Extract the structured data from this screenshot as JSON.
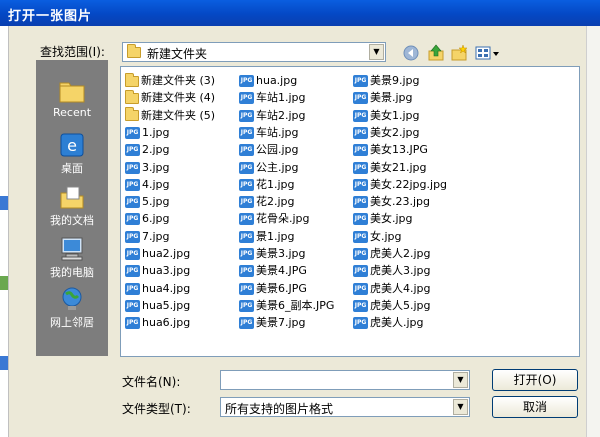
{
  "window": {
    "title": "打开一张图片"
  },
  "look_in": {
    "label": "查找范围(I):",
    "value": "新建文件夹"
  },
  "toolbar": {
    "back_icon": "back-icon",
    "up_icon": "up-folder-icon",
    "new_folder_icon": "new-folder-icon",
    "view_menu_icon": "view-menu-icon"
  },
  "places": [
    {
      "label": "Recent",
      "icon": "recent-icon"
    },
    {
      "label": "桌面",
      "icon": "desktop-icon"
    },
    {
      "label": "我的文档",
      "icon": "my-documents-icon"
    },
    {
      "label": "我的电脑",
      "icon": "my-computer-icon"
    },
    {
      "label": "网上邻居",
      "icon": "network-icon"
    }
  ],
  "files": {
    "col1": [
      {
        "name": "新建文件夹 (3)",
        "type": "folder"
      },
      {
        "name": "新建文件夹 (4)",
        "type": "folder"
      },
      {
        "name": "新建文件夹 (5)",
        "type": "folder"
      },
      {
        "name": "1.jpg",
        "type": "jpg"
      },
      {
        "name": "2.jpg",
        "type": "jpg"
      },
      {
        "name": "3.jpg",
        "type": "jpg"
      },
      {
        "name": "4.jpg",
        "type": "jpg"
      },
      {
        "name": "5.jpg",
        "type": "jpg"
      },
      {
        "name": "6.jpg",
        "type": "jpg"
      },
      {
        "name": "7.jpg",
        "type": "jpg"
      },
      {
        "name": "hua2.jpg",
        "type": "jpg"
      },
      {
        "name": "hua3.jpg",
        "type": "jpg"
      },
      {
        "name": "hua4.jpg",
        "type": "jpg"
      },
      {
        "name": "hua5.jpg",
        "type": "jpg"
      },
      {
        "name": "hua6.jpg",
        "type": "jpg"
      }
    ],
    "col2": [
      {
        "name": "hua.jpg",
        "type": "jpg"
      },
      {
        "name": "车站1.jpg",
        "type": "jpg"
      },
      {
        "name": "车站2.jpg",
        "type": "jpg"
      },
      {
        "name": "车站.jpg",
        "type": "jpg"
      },
      {
        "name": "公园.jpg",
        "type": "jpg"
      },
      {
        "name": "公主.jpg",
        "type": "jpg"
      },
      {
        "name": "花1.jpg",
        "type": "jpg"
      },
      {
        "name": "花2.jpg",
        "type": "jpg"
      },
      {
        "name": "花骨朵.jpg",
        "type": "jpg"
      },
      {
        "name": "景1.jpg",
        "type": "jpg"
      },
      {
        "name": "美景3.jpg",
        "type": "jpg"
      },
      {
        "name": "美景4.JPG",
        "type": "jpg"
      },
      {
        "name": "美景6.JPG",
        "type": "jpg"
      },
      {
        "name": "美景6_副本.JPG",
        "type": "jpg"
      },
      {
        "name": "美景7.jpg",
        "type": "jpg"
      }
    ],
    "col3": [
      {
        "name": "美景9.jpg",
        "type": "jpg"
      },
      {
        "name": "美景.jpg",
        "type": "jpg"
      },
      {
        "name": "美女1.jpg",
        "type": "jpg"
      },
      {
        "name": "美女2.jpg",
        "type": "jpg"
      },
      {
        "name": "美女13.JPG",
        "type": "jpg"
      },
      {
        "name": "美女21.jpg",
        "type": "jpg"
      },
      {
        "name": "美女.22jpg.jpg",
        "type": "jpg"
      },
      {
        "name": "美女.23.jpg",
        "type": "jpg"
      },
      {
        "name": "美女.jpg",
        "type": "jpg"
      },
      {
        "name": "女.jpg",
        "type": "jpg"
      },
      {
        "name": "虎美人2.jpg",
        "type": "jpg"
      },
      {
        "name": "虎美人3.jpg",
        "type": "jpg"
      },
      {
        "name": "虎美人4.jpg",
        "type": "jpg"
      },
      {
        "name": "虎美人5.jpg",
        "type": "jpg"
      },
      {
        "name": "虎美人.jpg",
        "type": "jpg"
      }
    ]
  },
  "filename": {
    "label": "文件名(N):",
    "value": ""
  },
  "filetype": {
    "label": "文件类型(T):",
    "value": "所有支持的图片格式"
  },
  "buttons": {
    "open": "打开(O)",
    "cancel": "取消"
  },
  "jpg_badge": "JPG",
  "colors": {
    "title_bar": "#0a5ee0",
    "places_bar": "#7d7d7d",
    "dialog_bg": "#ece9d8",
    "list_border": "#7f9db9"
  }
}
